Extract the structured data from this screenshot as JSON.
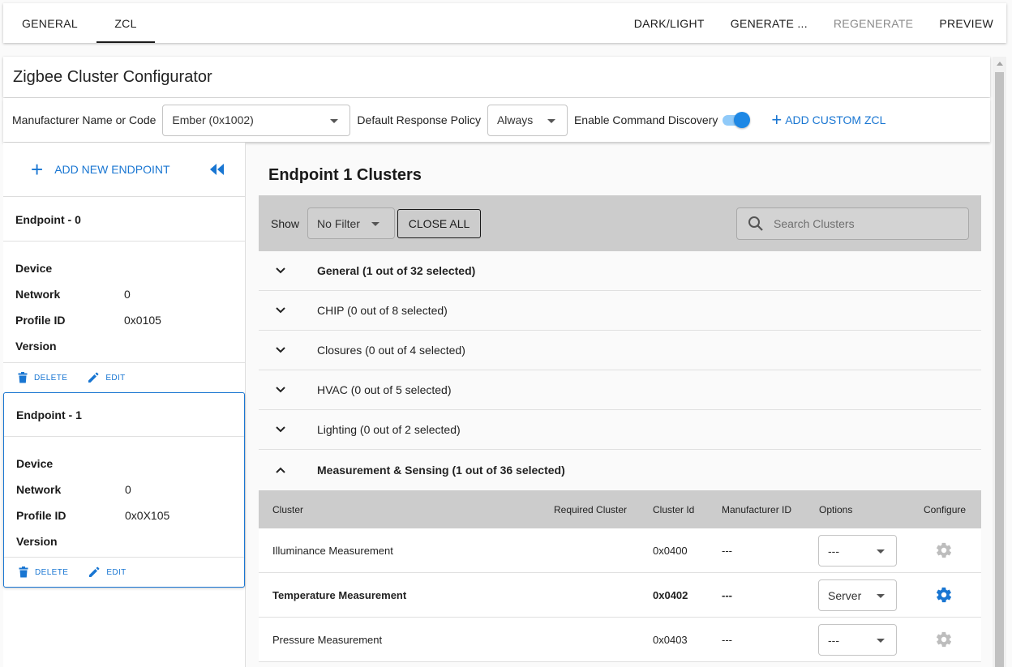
{
  "tabs": [
    {
      "label": "GENERAL"
    },
    {
      "label": "ZCL"
    }
  ],
  "top_actions": {
    "dark_light": "DARK/LIGHT",
    "generate": "GENERATE ...",
    "regenerate": "REGENERATE",
    "preview": "PREVIEW"
  },
  "title": "Zigbee Cluster Configurator",
  "options": {
    "manufacturer_label": "Manufacturer Name or Code",
    "manufacturer_value": "Ember (0x1002)",
    "response_policy_label": "Default Response Policy",
    "response_policy_value": "Always",
    "command_discovery_label": "Enable Command Discovery",
    "command_discovery_enabled": true,
    "add_custom_zcl": "ADD CUSTOM ZCL"
  },
  "sidebar": {
    "add_endpoint": "ADD NEW ENDPOINT",
    "endpoints": [
      {
        "title": "Endpoint - 0",
        "device_label": "Device",
        "device_value": "",
        "network_label": "Network",
        "network_value": "0",
        "profile_label": "Profile ID",
        "profile_value": "0x0105",
        "version_label": "Version",
        "version_value": "",
        "delete": "DELETE",
        "edit": "EDIT"
      },
      {
        "title": "Endpoint - 1",
        "device_label": "Device",
        "device_value": "",
        "network_label": "Network",
        "network_value": "0",
        "profile_label": "Profile ID",
        "profile_value": "0x0X105",
        "version_label": "Version",
        "version_value": "",
        "delete": "DELETE",
        "edit": "EDIT"
      }
    ]
  },
  "main": {
    "title": "Endpoint 1 Clusters",
    "show_label": "Show",
    "filter_value": "No Filter",
    "close_all": "CLOSE ALL",
    "search_placeholder": "Search Clusters",
    "groups": [
      {
        "label": "General (1 out of 32 selected)",
        "expanded": false
      },
      {
        "label": "CHIP (0 out of 8 selected)",
        "expanded": false
      },
      {
        "label": "Closures (0 out of 4 selected)",
        "expanded": false
      },
      {
        "label": "HVAC (0 out of 5 selected)",
        "expanded": false
      },
      {
        "label": "Lighting (0 out of 2 selected)",
        "expanded": false
      },
      {
        "label": "Measurement & Sensing (1 out of 36 selected)",
        "expanded": true
      }
    ],
    "table": {
      "headers": [
        "Cluster",
        "Required Cluster",
        "Cluster Id",
        "Manufacturer ID",
        "Options",
        "Configure"
      ],
      "rows": [
        {
          "cluster": "Illuminance Measurement",
          "required": "",
          "cluster_id": "0x0400",
          "manufacturer_id": "---",
          "option": "---",
          "enabled": false
        },
        {
          "cluster": "Temperature Measurement",
          "required": "",
          "cluster_id": "0x0402",
          "manufacturer_id": "---",
          "option": "Server",
          "enabled": true
        },
        {
          "cluster": "Pressure Measurement",
          "required": "",
          "cluster_id": "0x0403",
          "manufacturer_id": "---",
          "option": "---",
          "enabled": false
        }
      ]
    }
  },
  "colors": {
    "accent": "#1976d2",
    "gear_disabled": "#bdbdbd",
    "filterbar": "#cccccc"
  }
}
